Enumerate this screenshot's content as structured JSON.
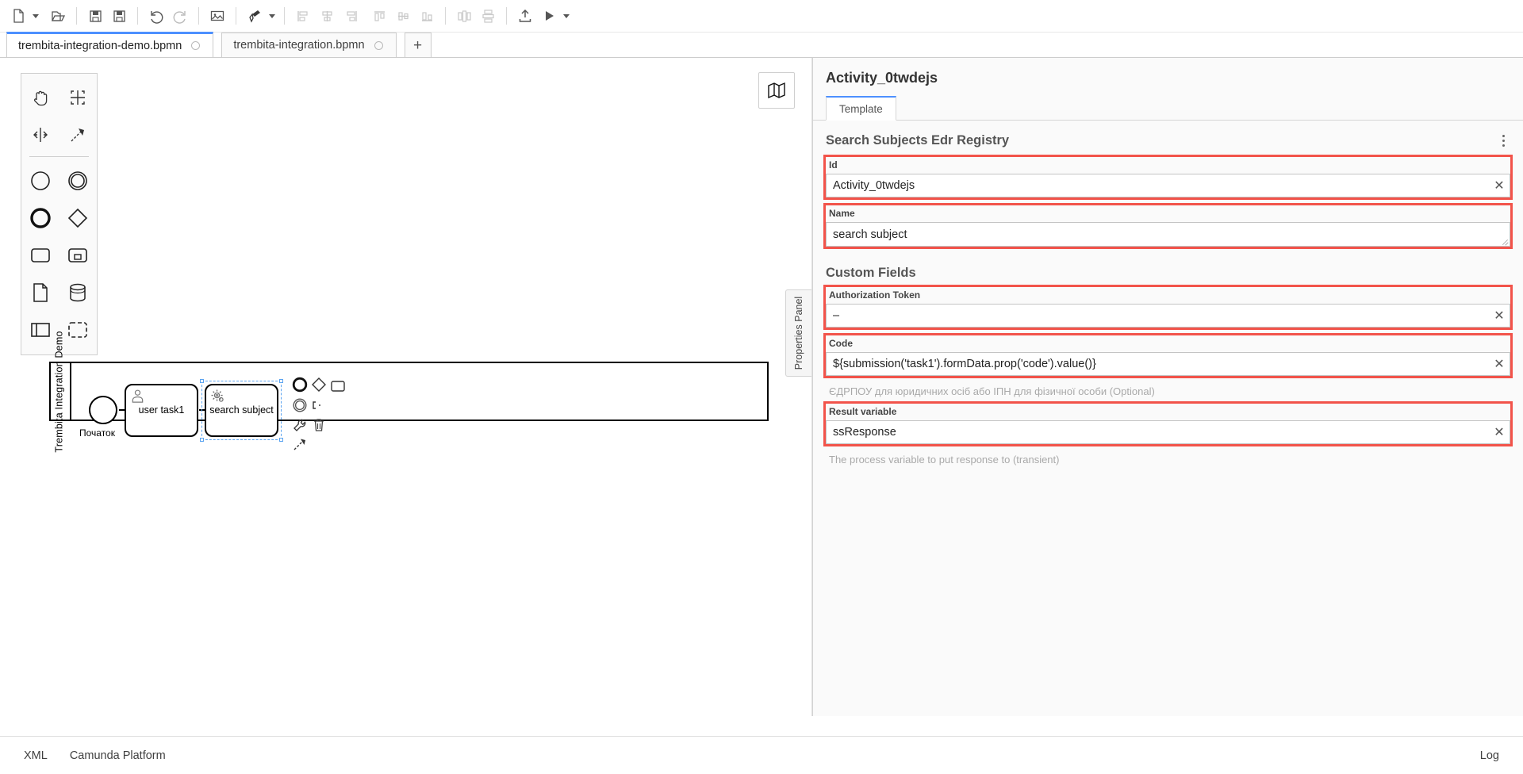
{
  "toolbar": {
    "items": [
      {
        "name": "new-file-button",
        "icon": "file-new-icon",
        "caret": true
      },
      {
        "name": "open-file-button",
        "icon": "folder-open-icon",
        "caret": false
      },
      {
        "name": "save-button",
        "icon": "save-icon",
        "caret": false
      },
      {
        "name": "save-as-button",
        "icon": "save-as-icon",
        "caret": false
      },
      {
        "name": "undo-button",
        "icon": "undo-icon",
        "caret": false
      },
      {
        "name": "redo-button",
        "icon": "redo-icon",
        "caret": false
      },
      {
        "name": "export-image-button",
        "icon": "image-icon",
        "caret": false
      },
      {
        "name": "format-brush-button",
        "icon": "paintbrush-icon",
        "caret": true
      },
      {
        "name": "align-left-button",
        "icon": "align-left-icon",
        "caret": false
      },
      {
        "name": "align-center-button",
        "icon": "align-center-icon",
        "caret": false
      },
      {
        "name": "align-right-button",
        "icon": "align-right-icon",
        "caret": false
      },
      {
        "name": "align-top-button",
        "icon": "align-top-icon",
        "caret": false
      },
      {
        "name": "align-middle-button",
        "icon": "align-middle-icon",
        "caret": false
      },
      {
        "name": "align-bottom-button",
        "icon": "align-bottom-icon",
        "caret": false
      },
      {
        "name": "distribute-horizontal-button",
        "icon": "distribute-horizontal-icon",
        "caret": false
      },
      {
        "name": "distribute-vertical-button",
        "icon": "distribute-vertical-icon",
        "caret": false
      },
      {
        "name": "deploy-button",
        "icon": "upload-icon",
        "caret": false
      },
      {
        "name": "run-button",
        "icon": "play-icon",
        "caret": true
      }
    ]
  },
  "tabs": {
    "items": [
      {
        "label": "trembita-integration-demo.bpmn",
        "active": true,
        "dirty": true
      },
      {
        "label": "trembita-integration.bpmn",
        "active": false,
        "dirty": true
      }
    ],
    "add_label": "+"
  },
  "canvas": {
    "palette": {
      "rows": [
        [
          {
            "name": "palette-hand-tool",
            "icon": "hand-icon"
          },
          {
            "name": "palette-lasso-tool",
            "icon": "lasso-icon"
          }
        ],
        [
          {
            "name": "palette-space-tool",
            "icon": "space-tool-icon"
          },
          {
            "name": "palette-connect-tool",
            "icon": "connect-icon"
          }
        ],
        [
          {
            "name": "palette-start-event",
            "icon": "start-event-icon"
          },
          {
            "name": "palette-intermediate-event",
            "icon": "intermediate-event-icon"
          }
        ],
        [
          {
            "name": "palette-end-event",
            "icon": "end-event-icon"
          },
          {
            "name": "palette-gateway",
            "icon": "gateway-icon"
          }
        ],
        [
          {
            "name": "palette-task",
            "icon": "task-icon"
          },
          {
            "name": "palette-subprocess-expanded",
            "icon": "subprocess-icon"
          }
        ],
        [
          {
            "name": "palette-data-object",
            "icon": "data-object-icon"
          },
          {
            "name": "palette-data-store",
            "icon": "data-store-icon"
          }
        ],
        [
          {
            "name": "palette-participant",
            "icon": "participant-icon"
          },
          {
            "name": "palette-group",
            "icon": "group-icon"
          }
        ]
      ]
    },
    "minimap_button": {
      "name": "minimap-toggle",
      "icon": "map-icon"
    },
    "diagram": {
      "pool_name": "Trembita Integration Demo",
      "start_event_label": "Початок",
      "tasks": [
        {
          "label": "user task1",
          "type": "user-task"
        },
        {
          "label": "search subject",
          "type": "service-task",
          "selected": true
        }
      ]
    },
    "properties_panel_tab_label": "Properties Panel"
  },
  "properties": {
    "title": "Activity_0twdejs",
    "tabs": [
      {
        "label": "Template",
        "active": true
      }
    ],
    "template_group": {
      "title": "Search Subjects Edr Registry",
      "menu_icon": "kebab-menu-icon"
    },
    "fields": [
      {
        "key": "id",
        "label": "Id",
        "value": "Activity_0twdejs",
        "highlight": true,
        "clearable": true,
        "multiline": false,
        "description": ""
      },
      {
        "key": "name",
        "label": "Name",
        "value": "search subject",
        "highlight": true,
        "clearable": false,
        "multiline": true,
        "description": ""
      }
    ],
    "custom_fields_title": "Custom Fields",
    "custom_fields": [
      {
        "key": "authorization_token",
        "label": "Authorization Token",
        "value": "–",
        "highlight": true,
        "clearable": true,
        "multiline": false,
        "description": ""
      },
      {
        "key": "code",
        "label": "Code",
        "value": "${submission('task1').formData.prop('code').value()}",
        "highlight": true,
        "clearable": true,
        "multiline": false,
        "description": "ЄДРПОУ для юридичних осіб або ІПН для фізичної особи (Optional)"
      },
      {
        "key": "result_variable",
        "label": "Result variable",
        "value": "ssResponse",
        "highlight": true,
        "clearable": true,
        "multiline": false,
        "description": "The process variable to put response to (transient)"
      }
    ],
    "clear_glyph": "✕"
  },
  "statusbar": {
    "left_items": [
      {
        "name": "statusbar-xml",
        "label": "XML"
      },
      {
        "name": "statusbar-camunda-platform",
        "label": "Camunda Platform"
      }
    ],
    "right_items": [
      {
        "name": "statusbar-log",
        "label": "Log"
      }
    ]
  },
  "colors": {
    "accent": "#4d90ff",
    "highlight": "#f2534a",
    "selection": "#5aa3f0",
    "panel_bg": "#fafafa"
  }
}
